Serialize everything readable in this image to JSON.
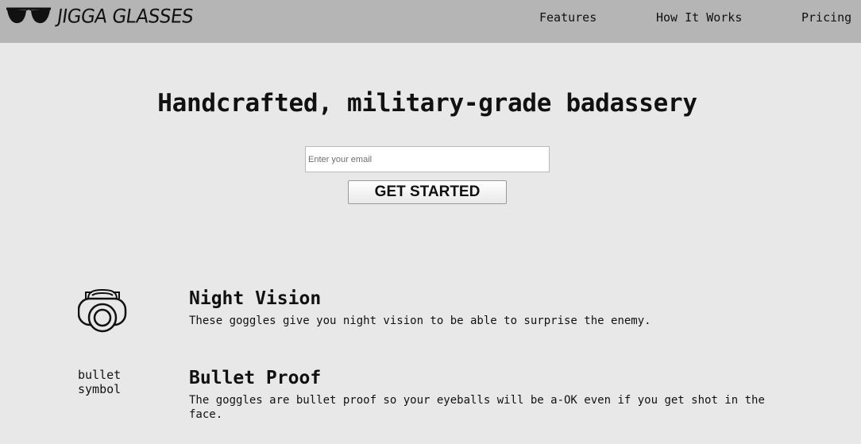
{
  "header": {
    "logo_text": "JIGGA GLASSES",
    "logo_icon": "sunglasses-icon",
    "nav": [
      {
        "label": "Features"
      },
      {
        "label": "How It Works"
      },
      {
        "label": "Pricing"
      }
    ]
  },
  "hero": {
    "title": "Handcrafted, military-grade badassery",
    "email_placeholder": "Enter your email",
    "email_value": "",
    "cta_label": "GET STARTED"
  },
  "features": [
    {
      "icon": "night-vision-goggles-icon",
      "title": "Night Vision",
      "description": "These goggles give you night vision to be able to surprise the enemy."
    },
    {
      "icon_alt_text": "bullet symbol",
      "title": "Bullet Proof",
      "description": "The goggles are bullet proof so your eyeballs will be a-OK even if you get shot in the face."
    }
  ],
  "colors": {
    "page_background": "#e8e8e8",
    "header_background": "#b5b5b5",
    "text": "#111111"
  }
}
